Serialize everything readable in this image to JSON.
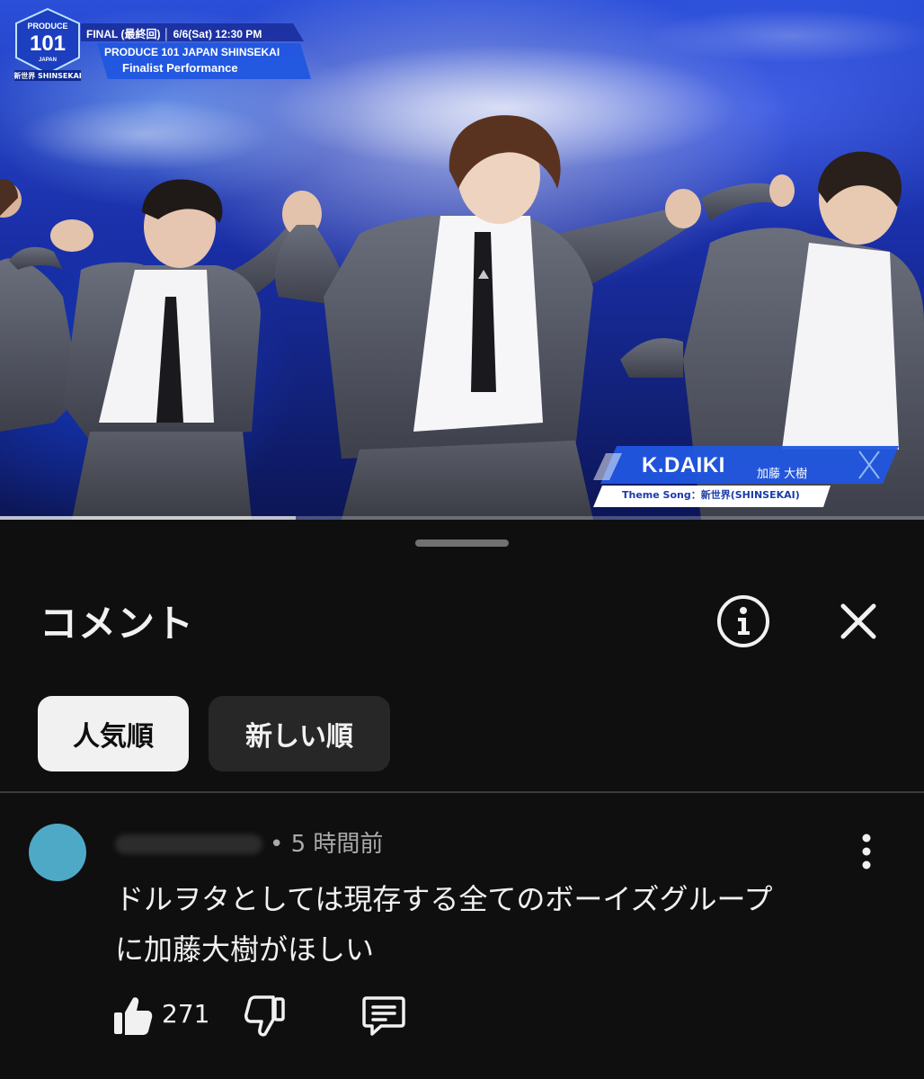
{
  "video": {
    "logo": {
      "number": "101",
      "brand_top": "PRODUCE",
      "brand_sub": "JAPAN",
      "brand_bottom": "新世界 SHINSEKAI"
    },
    "broadcast": {
      "line1": "FINAL (最終回) │ 6/6(Sat) 12:30 PM",
      "line2": "PRODUCE 101 JAPAN SHINSEKAI",
      "line3": "Finalist Performance"
    },
    "performer": {
      "romaji": "K.DAIKI",
      "kanji": "加藤 大樹",
      "theme_song": "Theme Song：新世界(SHINSEKAI)"
    },
    "progress": 0.32,
    "colors": {
      "stage_blue": "#1a2fa8",
      "caption_blue": "#2156e0"
    }
  },
  "sheet": {
    "title": "コメント",
    "info_icon": "info-circle-icon",
    "close_icon": "close-icon",
    "sort_chips": [
      {
        "label": "人気順",
        "selected": true
      },
      {
        "label": "新しい順",
        "selected": false
      }
    ]
  },
  "comment": {
    "time": "• 5 時間前",
    "text_lines": [
      "ドルヲタとしては現存する全てのボーイズグループ",
      "に加藤大樹がほしい"
    ],
    "like_count": "271",
    "avatar_color": "#4ea9c7",
    "icons": {
      "like": "thumbs-up-icon",
      "dislike": "thumbs-down-icon",
      "reply": "comment-bubble-icon",
      "more": "more-vertical-icon"
    }
  }
}
